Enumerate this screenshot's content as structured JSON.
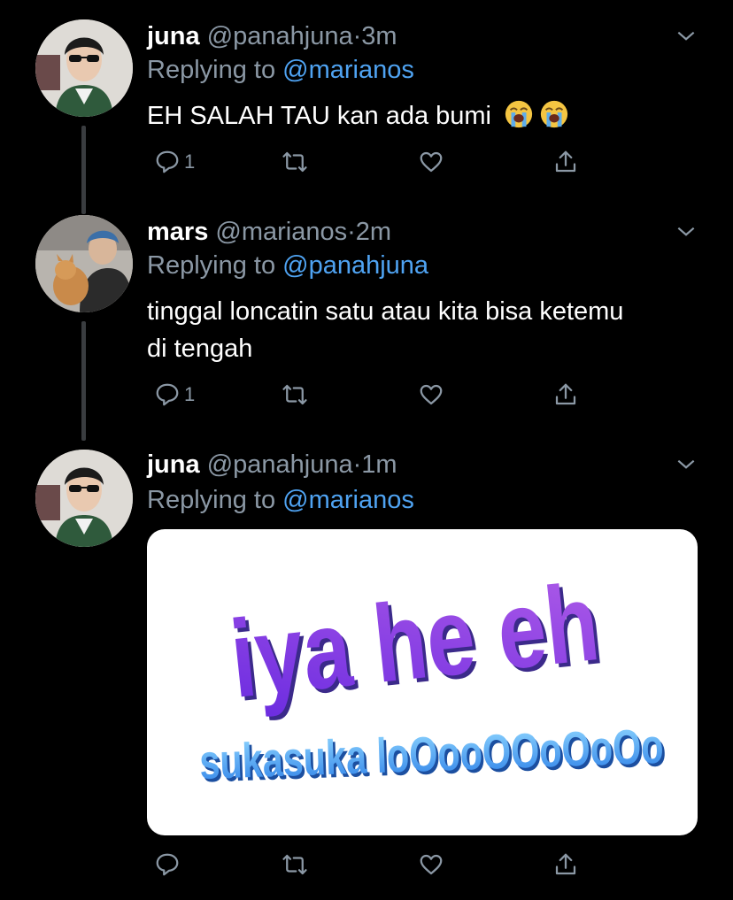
{
  "tweets": [
    {
      "name": "juna",
      "handle": "@panahjuna",
      "dot": "·",
      "time": "3m",
      "replying_prefix": "Replying to",
      "replying_to": "@marianos",
      "text": "EH SALAH TAU kan ada bumi",
      "emojis": [
        "loudly-crying-face",
        "loudly-crying-face"
      ],
      "reply_count": "1"
    },
    {
      "name": "mars",
      "handle": "@marianos",
      "dot": "·",
      "time": "2m",
      "replying_prefix": "Replying to",
      "replying_to": "@panahjuna",
      "text_line1": "tinggal loncatin satu atau kita bisa ketemu",
      "text_line2": "di tengah",
      "reply_count": "1"
    },
    {
      "name": "juna",
      "handle": "@panahjuna",
      "dot": "·",
      "time": "1m",
      "replying_prefix": "Replying to",
      "replying_to": "@marianos",
      "media_text_top": "iya he eh",
      "media_text_bottom": "sukasuka loOooOOoOoOo",
      "reply_count": ""
    }
  ],
  "colors": {
    "background": "#000000",
    "secondary_text": "#8b98a5",
    "link": "#4fa3f2",
    "thread_line": "#3a3d40"
  },
  "icons": [
    "chevron-down-icon",
    "reply-icon",
    "retweet-icon",
    "like-icon",
    "share-icon"
  ]
}
